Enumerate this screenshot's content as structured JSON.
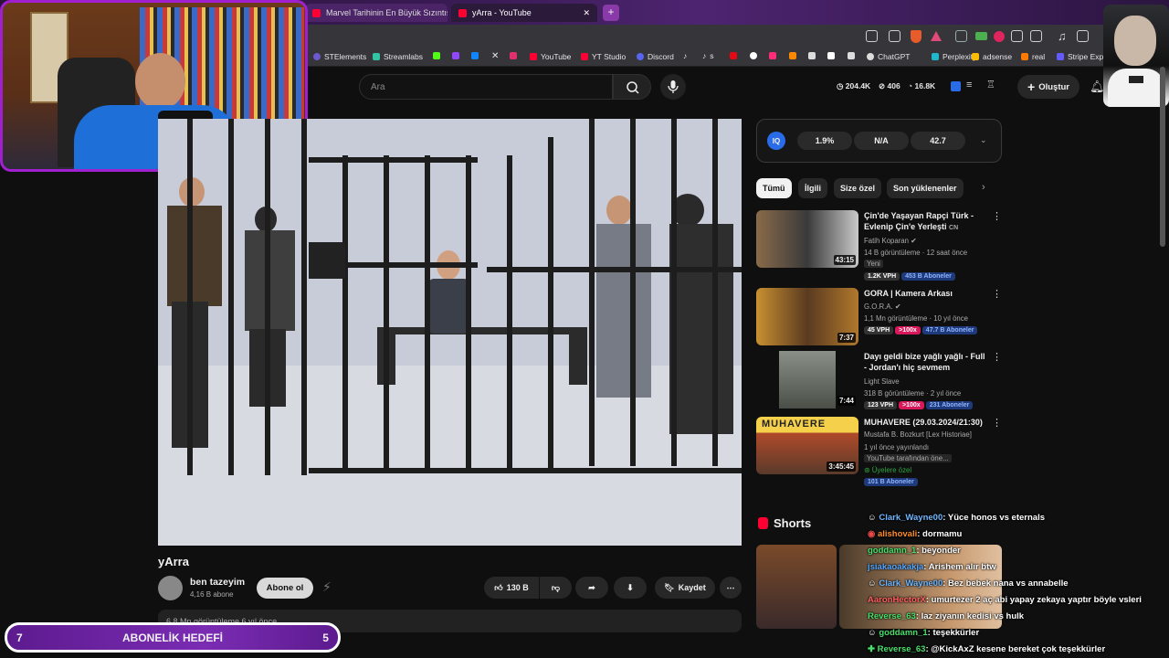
{
  "browser": {
    "tabs": [
      {
        "title": "Marvel Tarihinin En Büyük Sızıntısı! A"
      },
      {
        "title": "yArra - YouTube"
      }
    ],
    "bookmarks": [
      "STElements",
      "Streamlabs",
      "YouTube",
      "YT Studio",
      "Discord",
      "s",
      "ChatGPT",
      "Perplexity",
      "adsense",
      "real",
      "Stripe Expre"
    ]
  },
  "header": {
    "search_placeholder": "Ara",
    "stats": [
      "204.4K",
      "406",
      "16.8K"
    ],
    "create_label": "Oluştur"
  },
  "video": {
    "title": "yArra",
    "channel": "ben tazeyim",
    "subscribers": "4,16 B abone",
    "subscribe_label": "Abone ol",
    "likes": "130 B",
    "save_label": "Kaydet",
    "description_preview": "6,8 Mn görüntüleme  6 yıl önce"
  },
  "iq_panel": {
    "logo": "IQ",
    "values": [
      "1.9%",
      "N/A",
      "42.7"
    ]
  },
  "chips": [
    "Tümü",
    "İlgili",
    "Size özel",
    "Son yüklenenler"
  ],
  "recommendations": [
    {
      "title": "Çin'de Yaşayan Rapçi Türk - Evlenip Çin'e Yerleşti",
      "title_suffix": "CN",
      "channel": "Fatih Koparan",
      "verified": true,
      "meta": "14 B görüntüleme · 12 saat önce",
      "extra": "Yeni",
      "tags": [
        "1.2K VPH",
        "453 B Aboneler"
      ],
      "duration": "43:15"
    },
    {
      "title": "GORA | Kamera Arkası",
      "channel": "G.O.R.A.",
      "verified": true,
      "meta": "1,1 Mn görüntüleme · 10 yıl önce",
      "tags": [
        "45 VPH",
        ">100x",
        "47.7 B Aboneler"
      ],
      "duration": "7:37"
    },
    {
      "title": "Dayı geldi bize yağlı yağlı - Full - Jordan'ı hiç sevmem",
      "channel": "Light Slave",
      "meta": "318 B görüntüleme · 2 yıl önce",
      "tags": [
        "123 VPH",
        ">100x",
        "231 Aboneler"
      ],
      "duration": "7:44"
    },
    {
      "title": "MUHAVERE (29.03.2024/21:30)",
      "channel": "Mustafa B. Bozkurt [Lex Historiae]",
      "meta": "1 yıl önce yayınlandı",
      "extra": "YouTube tarafından öne...",
      "members": "Üyelere özel",
      "tags": [
        "101 B Aboneler"
      ],
      "duration": "3:45:45",
      "thumb_text": "MUHAVERE"
    }
  ],
  "shorts": {
    "title": "Shorts"
  },
  "chat": [
    {
      "user": "Clark_Wayne00",
      "color": "#6fb7ff",
      "msg": ": Yüce honos vs eternals"
    },
    {
      "user": "alishovali",
      "color": "#ff8c2a",
      "msg": ": dormamu"
    },
    {
      "user": "goddamn_1",
      "color": "#49e06b",
      "msg": ": beyonder"
    },
    {
      "user": "jsiakaoakakja",
      "color": "#56a8ff",
      "msg": ": Arishem alır btw"
    },
    {
      "user": "Clark_Wayne00",
      "color": "#6fb7ff",
      "msg": ": Bez bebek nana vs annabelle"
    },
    {
      "user": "AaronHectorX",
      "color": "#ff5f5f",
      "msg": ": umurtezer 2 aç abi yapay zekaya yaptır böyle vsleri"
    },
    {
      "user": "Reverse_63",
      "color": "#49e06b",
      "msg": ": laz ziyanın kedisi vs hulk"
    },
    {
      "user": "goddamn_1",
      "color": "#49e06b",
      "msg": ": teşekkürler"
    },
    {
      "user": "Reverse_63",
      "color": "#49e06b",
      "msg": ": @KickAxZ kesene bereket çok teşekkürler"
    }
  ],
  "goal": {
    "left": "7",
    "label": "ABONELİK HEDEFİ",
    "right": "5"
  }
}
